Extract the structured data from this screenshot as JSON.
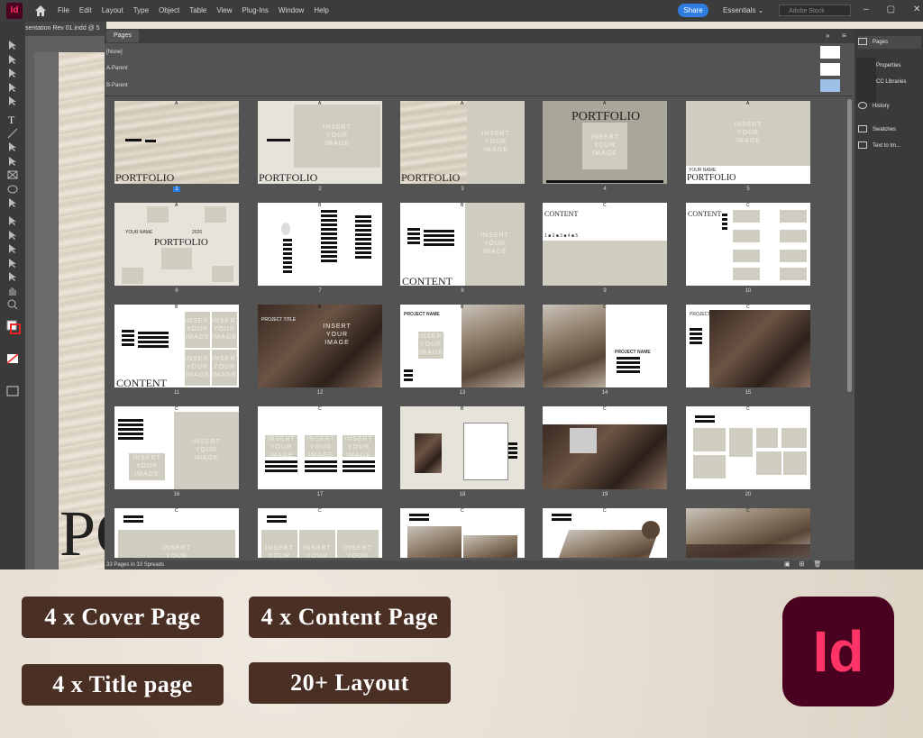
{
  "app": {
    "logo_text": "Id",
    "menu": [
      "File",
      "Edit",
      "Layout",
      "Type",
      "Object",
      "Table",
      "View",
      "Plug-Ins",
      "Window",
      "Help"
    ],
    "share_label": "Share",
    "workspace": "Essentials",
    "search_placeholder": "Adobe Stock"
  },
  "document": {
    "tab_title": "sentation Rev 01.indd @ 5",
    "big_text": "PC"
  },
  "pages_panel": {
    "title": "Pages",
    "parents": [
      "[None]",
      "A-Parent",
      "B-Parent"
    ],
    "status": "33 Pages in 33 Spreads",
    "pages": [
      {
        "num": "1",
        "prefix": "A",
        "selected": true
      },
      {
        "num": "2",
        "prefix": "A"
      },
      {
        "num": "3",
        "prefix": "A"
      },
      {
        "num": "4",
        "prefix": "A"
      },
      {
        "num": "5",
        "prefix": "A"
      },
      {
        "num": "6",
        "prefix": "A"
      },
      {
        "num": "7",
        "prefix": "B"
      },
      {
        "num": "8",
        "prefix": "B"
      },
      {
        "num": "9",
        "prefix": "C"
      },
      {
        "num": "10",
        "prefix": "C"
      },
      {
        "num": "11",
        "prefix": "B"
      },
      {
        "num": "12",
        "prefix": "B"
      },
      {
        "num": "13",
        "prefix": "B"
      },
      {
        "num": "14",
        "prefix": "C"
      },
      {
        "num": "15",
        "prefix": "C"
      },
      {
        "num": "16",
        "prefix": "C"
      },
      {
        "num": "17",
        "prefix": "C"
      },
      {
        "num": "18",
        "prefix": "B"
      },
      {
        "num": "19",
        "prefix": "C"
      },
      {
        "num": "20",
        "prefix": "C"
      },
      {
        "num": "",
        "prefix": "C"
      },
      {
        "num": "",
        "prefix": "C"
      },
      {
        "num": "",
        "prefix": "C"
      },
      {
        "num": "",
        "prefix": "C"
      },
      {
        "num": "",
        "prefix": "C"
      }
    ],
    "thumb_text": {
      "portfolio": "PORTFOLIO",
      "insert": "INSERT YOUR IMAGE",
      "content": "CONTENT",
      "project_name": "PROJECT NAME",
      "project_title": "PROJECT TITLE",
      "your_name": "YOUR NAME",
      "year": "2026"
    }
  },
  "right_dock": {
    "items": [
      "Pages",
      "Properties",
      "CC Libraries",
      "History",
      "Swatches",
      "Text to Im..."
    ]
  },
  "promo": {
    "badges": [
      "4 x Cover Page",
      "4 x Content Page",
      "4 x Title page",
      "20+ Layout"
    ],
    "logo_text": "Id"
  },
  "colors": {
    "badge": "#4a2f24",
    "id_bg": "#49021f",
    "id_fg": "#ff3366",
    "share": "#2f7de1"
  }
}
